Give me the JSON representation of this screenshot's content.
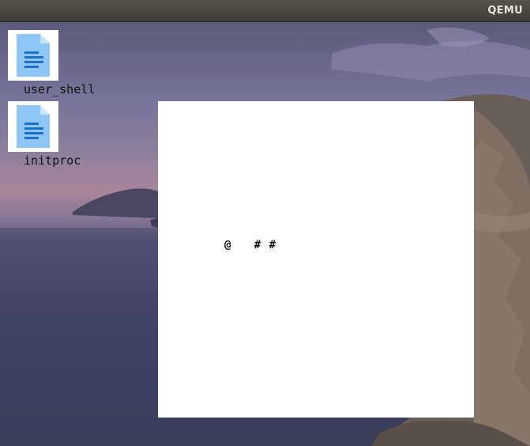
{
  "window": {
    "title": "QEMU"
  },
  "desktop": {
    "icons": [
      {
        "label": "user_shell",
        "icon": "text-file-icon"
      },
      {
        "label": "initproc",
        "icon": "text-file-icon"
      }
    ]
  },
  "vm_screen": {
    "text": "@   # #",
    "background": "#ffffff"
  },
  "colors": {
    "titlebar": "#4a4843",
    "file_icon": "#8ec7f5",
    "file_icon_lines": "#1f6fc4"
  }
}
